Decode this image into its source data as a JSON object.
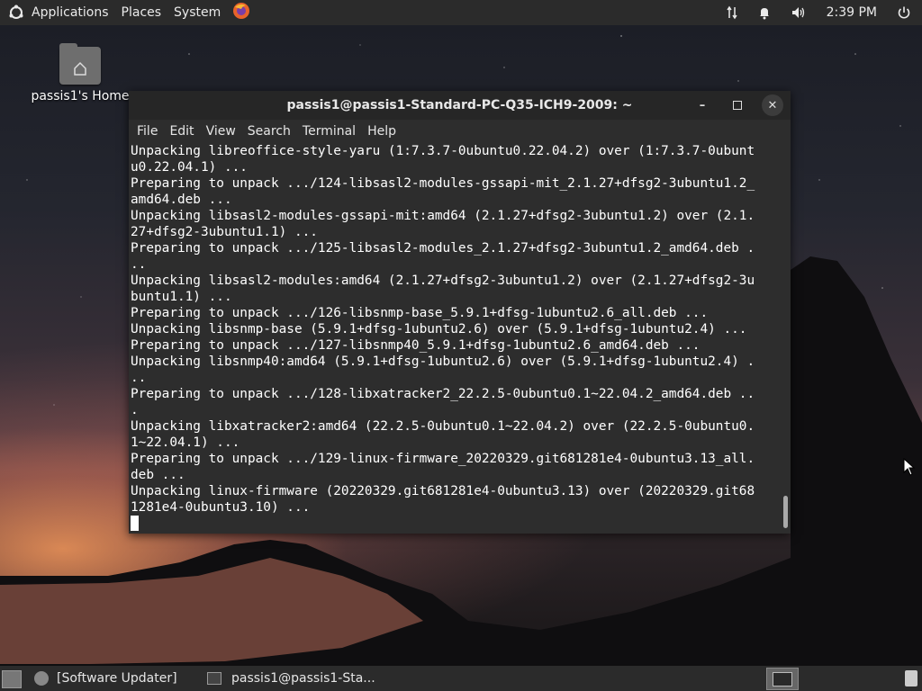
{
  "top_panel": {
    "menus": [
      "Applications",
      "Places",
      "System"
    ],
    "clock": "2:39 PM"
  },
  "desktop": {
    "home_label": "passis1's Home"
  },
  "terminal": {
    "title": "passis1@passis1-Standard-PC-Q35-ICH9-2009: ~",
    "menus": [
      "File",
      "Edit",
      "View",
      "Search",
      "Terminal",
      "Help"
    ],
    "lines": [
      "Unpacking libreoffice-style-yaru (1:7.3.7-0ubuntu0.22.04.2) over (1:7.3.7-0ubunt",
      "u0.22.04.1) ...",
      "Preparing to unpack .../124-libsasl2-modules-gssapi-mit_2.1.27+dfsg2-3ubuntu1.2_",
      "amd64.deb ...",
      "Unpacking libsasl2-modules-gssapi-mit:amd64 (2.1.27+dfsg2-3ubuntu1.2) over (2.1.",
      "27+dfsg2-3ubuntu1.1) ...",
      "Preparing to unpack .../125-libsasl2-modules_2.1.27+dfsg2-3ubuntu1.2_amd64.deb .",
      "..",
      "Unpacking libsasl2-modules:amd64 (2.1.27+dfsg2-3ubuntu1.2) over (2.1.27+dfsg2-3u",
      "buntu1.1) ...",
      "Preparing to unpack .../126-libsnmp-base_5.9.1+dfsg-1ubuntu2.6_all.deb ...",
      "Unpacking libsnmp-base (5.9.1+dfsg-1ubuntu2.6) over (5.9.1+dfsg-1ubuntu2.4) ...",
      "Preparing to unpack .../127-libsnmp40_5.9.1+dfsg-1ubuntu2.6_amd64.deb ...",
      "Unpacking libsnmp40:amd64 (5.9.1+dfsg-1ubuntu2.6) over (5.9.1+dfsg-1ubuntu2.4) .",
      "..",
      "Preparing to unpack .../128-libxatracker2_22.2.5-0ubuntu0.1~22.04.2_amd64.deb ..",
      ".",
      "Unpacking libxatracker2:amd64 (22.2.5-0ubuntu0.1~22.04.2) over (22.2.5-0ubuntu0.",
      "1~22.04.1) ...",
      "Preparing to unpack .../129-linux-firmware_20220329.git681281e4-0ubuntu3.13_all.",
      "deb ...",
      "Unpacking linux-firmware (20220329.git681281e4-0ubuntu3.13) over (20220329.git68",
      "1281e4-0ubuntu3.10) ..."
    ]
  },
  "taskbar": {
    "items": [
      "[Software Updater]",
      "passis1@passis1-Sta..."
    ]
  }
}
